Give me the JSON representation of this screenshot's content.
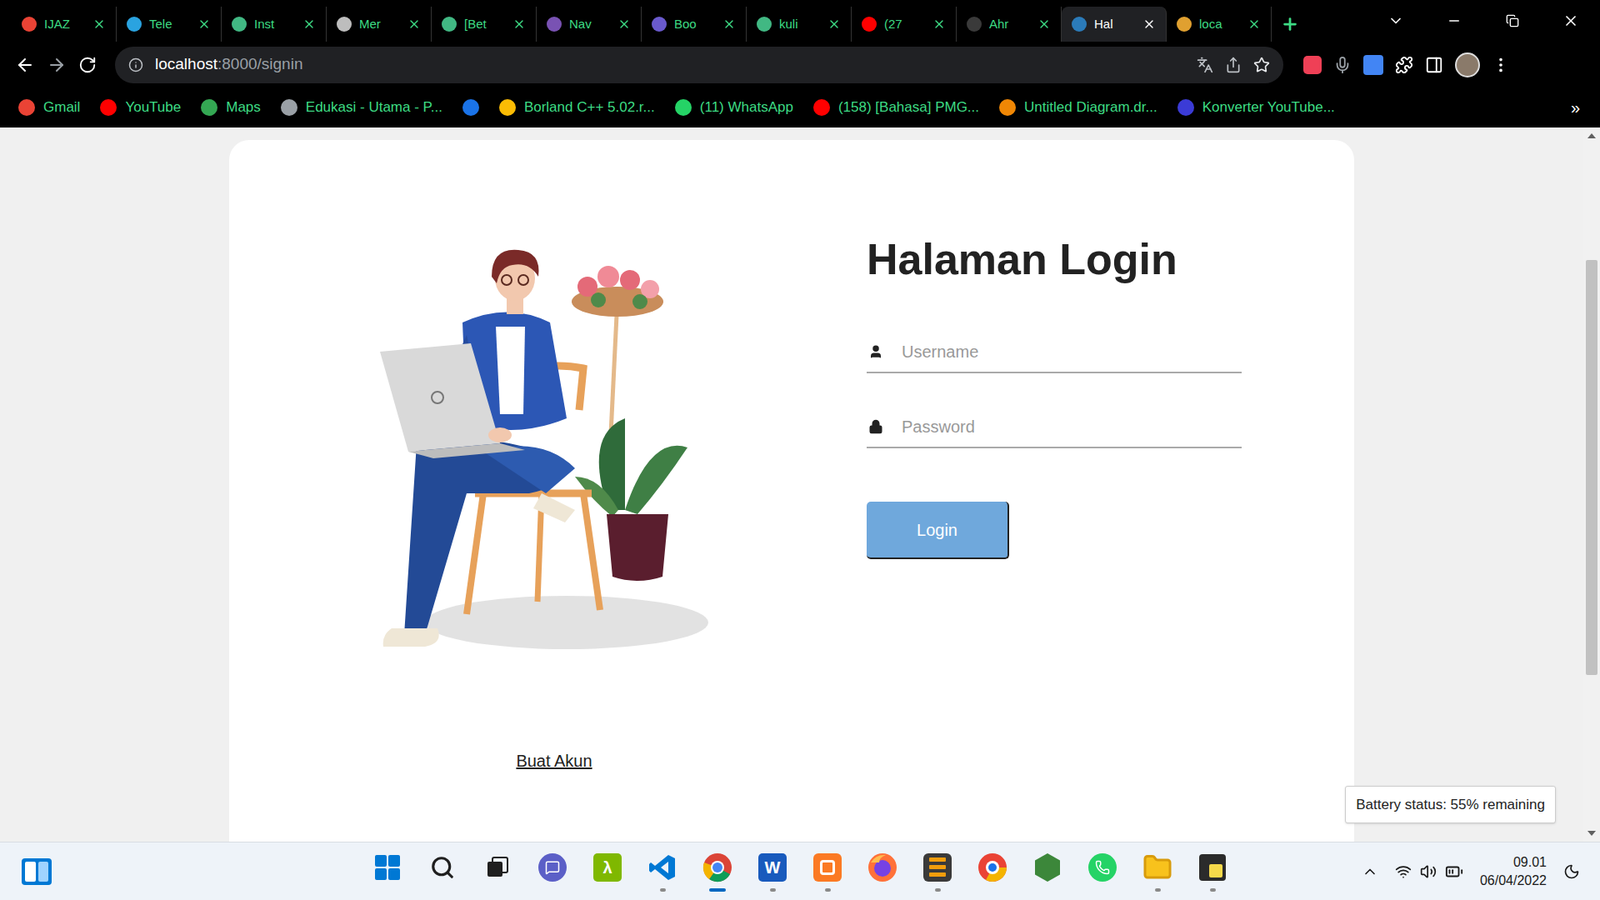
{
  "tabs": [
    {
      "label": "IJAZ",
      "selected": false,
      "color": "#ea4335"
    },
    {
      "label": "Tele",
      "selected": false,
      "color": "#2aa3e0"
    },
    {
      "label": "Inst",
      "selected": false,
      "color": "#41b883"
    },
    {
      "label": "Mer",
      "selected": false,
      "color": "#bdbdbd"
    },
    {
      "label": "[Bet",
      "selected": false,
      "color": "#41b883"
    },
    {
      "label": "Nav",
      "selected": false,
      "color": "#7952b3"
    },
    {
      "label": "Boo",
      "selected": false,
      "color": "#6a5acd"
    },
    {
      "label": "kuli",
      "selected": false,
      "color": "#41b883"
    },
    {
      "label": "(27",
      "selected": false,
      "color": "#ff0000"
    },
    {
      "label": "Ahr",
      "selected": false,
      "color": "#3a3a3a"
    },
    {
      "label": "Hal",
      "selected": true,
      "color": "#2b7bb9"
    },
    {
      "label": "loca",
      "selected": false,
      "color": "#e0a030"
    }
  ],
  "address_bar": {
    "host": "localhost",
    "path": ":8000/signin"
  },
  "bookmarks": [
    {
      "label": "Gmail",
      "color": "#ea4335"
    },
    {
      "label": "YouTube",
      "color": "#ff0000"
    },
    {
      "label": "Maps",
      "color": "#34a853"
    },
    {
      "label": "Edukasi - Utama - P...",
      "color": "#9aa0a6"
    },
    {
      "color": "#1a73e8"
    },
    {
      "label": "Borland C++ 5.02.r...",
      "color": "#fbbc04"
    },
    {
      "label": "(11) WhatsApp",
      "color": "#25d366"
    },
    {
      "label": "(158) [Bahasa] PMG...",
      "color": "#ff0000"
    },
    {
      "label": "Untitled Diagram.dr...",
      "color": "#f08705"
    },
    {
      "label": "Konverter YouTube...",
      "color": "#3b3bd6"
    }
  ],
  "bookmarks_overflow": "»",
  "page": {
    "title": "Halaman Login",
    "fields": [
      {
        "placeholder": "Username",
        "kind": "text"
      },
      {
        "placeholder": "Password",
        "kind": "password"
      }
    ],
    "submit": "Login",
    "register_link": "Buat Akun"
  },
  "scrollbar": {
    "start": 0.17,
    "level": 0.61
  },
  "tooltip": "Battery status: 55% remaining",
  "taskbar": {
    "apps": [
      {
        "running": false,
        "selected": false,
        "color": "#0078d4"
      },
      {
        "running": false,
        "selected": false,
        "color": "#1f1f1f"
      },
      {
        "running": false,
        "selected": false,
        "color": "#1f1f1f"
      },
      {
        "running": false,
        "selected": false,
        "color": "#5b5fc7"
      },
      {
        "running": false,
        "selected": false,
        "color": "#7fb800",
        "glyph": "λ"
      },
      {
        "running": true,
        "selected": false,
        "color": "#0078d4"
      },
      {
        "running": true,
        "selected": true,
        "color": "#4285f4"
      },
      {
        "running": true,
        "selected": false,
        "color": "#185abd",
        "glyph": "W"
      },
      {
        "running": true,
        "selected": false,
        "color": "#fb7a24"
      },
      {
        "running": false,
        "selected": false,
        "color": "#ff7139"
      },
      {
        "running": true,
        "selected": false,
        "color": "#f29d0c"
      },
      {
        "running": false,
        "selected": false,
        "color": "#f4b400"
      },
      {
        "running": false,
        "selected": false,
        "color": "#3c873a"
      },
      {
        "running": false,
        "selected": false,
        "color": "#25d366"
      },
      {
        "running": true,
        "selected": false,
        "color": "#f8c21c"
      },
      {
        "running": true,
        "selected": false,
        "color": "#f6d94a"
      }
    ],
    "clock": {
      "time": "09.01",
      "date": "06/04/2022"
    }
  }
}
